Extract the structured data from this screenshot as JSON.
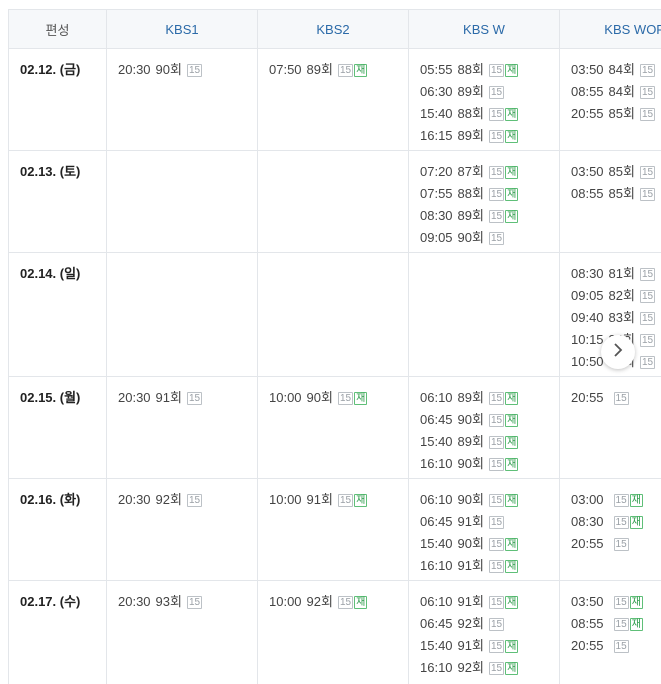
{
  "header": {
    "first": "편성",
    "channels": [
      "KBS1",
      "KBS2",
      "KBS W",
      "KBS WOR"
    ]
  },
  "icons": {
    "next": "chevron-right-icon"
  },
  "badge_labels": {
    "rating": "15",
    "rerun": "재"
  },
  "colors": {
    "channel_header": "#2b6aa8",
    "rerun_badge": "#2e9c4b",
    "rating_badge": "#9aa0a6"
  },
  "rows": [
    {
      "date": "02.12. (금)",
      "height": 102,
      "cells": [
        [
          {
            "time": "20:30",
            "ep": "90회",
            "re": false
          }
        ],
        [
          {
            "time": "07:50",
            "ep": "89회",
            "re": true
          }
        ],
        [
          {
            "time": "05:55",
            "ep": "88회",
            "re": true
          },
          {
            "time": "06:30",
            "ep": "89회",
            "re": false
          },
          {
            "time": "15:40",
            "ep": "88회",
            "re": true
          },
          {
            "time": "16:15",
            "ep": "89회",
            "re": true
          }
        ],
        [
          {
            "time": "03:50",
            "ep": "84회",
            "re": false
          },
          {
            "time": "08:55",
            "ep": "84회",
            "re": false
          },
          {
            "time": "20:55",
            "ep": "85회",
            "re": false
          }
        ]
      ]
    },
    {
      "date": "02.13. (토)",
      "height": 102,
      "cells": [
        [],
        [],
        [
          {
            "time": "07:20",
            "ep": "87회",
            "re": true
          },
          {
            "time": "07:55",
            "ep": "88회",
            "re": true
          },
          {
            "time": "08:30",
            "ep": "89회",
            "re": true
          },
          {
            "time": "09:05",
            "ep": "90회",
            "re": false
          }
        ],
        [
          {
            "time": "03:50",
            "ep": "85회",
            "re": false
          },
          {
            "time": "08:55",
            "ep": "85회",
            "re": false
          }
        ]
      ]
    },
    {
      "date": "02.14. (일)",
      "height": 124,
      "cells": [
        [],
        [],
        [],
        [
          {
            "time": "08:30",
            "ep": "81회",
            "re": false
          },
          {
            "time": "09:05",
            "ep": "82회",
            "re": false
          },
          {
            "time": "09:40",
            "ep": "83회",
            "re": false
          },
          {
            "time": "10:15",
            "ep": "84회",
            "re": false
          },
          {
            "time": "10:50",
            "ep": "85회",
            "re": false
          }
        ]
      ]
    },
    {
      "date": "02.15. (월)",
      "height": 102,
      "cells": [
        [
          {
            "time": "20:30",
            "ep": "91회",
            "re": false
          }
        ],
        [
          {
            "time": "10:00",
            "ep": "90회",
            "re": true
          }
        ],
        [
          {
            "time": "06:10",
            "ep": "89회",
            "re": true
          },
          {
            "time": "06:45",
            "ep": "90회",
            "re": true
          },
          {
            "time": "15:40",
            "ep": "89회",
            "re": true
          },
          {
            "time": "16:10",
            "ep": "90회",
            "re": true
          }
        ],
        [
          {
            "time": "20:55",
            "ep": "",
            "re": false
          }
        ]
      ]
    },
    {
      "date": "02.16. (화)",
      "height": 102,
      "cells": [
        [
          {
            "time": "20:30",
            "ep": "92회",
            "re": false
          }
        ],
        [
          {
            "time": "10:00",
            "ep": "91회",
            "re": true
          }
        ],
        [
          {
            "time": "06:10",
            "ep": "90회",
            "re": true
          },
          {
            "time": "06:45",
            "ep": "91회",
            "re": false
          },
          {
            "time": "15:40",
            "ep": "90회",
            "re": true
          },
          {
            "time": "16:10",
            "ep": "91회",
            "re": true
          }
        ],
        [
          {
            "time": "03:00",
            "ep": "",
            "re": true
          },
          {
            "time": "08:30",
            "ep": "",
            "re": true
          },
          {
            "time": "20:55",
            "ep": "",
            "re": false
          }
        ]
      ]
    },
    {
      "date": "02.17. (수)",
      "height": 102,
      "cells": [
        [
          {
            "time": "20:30",
            "ep": "93회",
            "re": false
          }
        ],
        [
          {
            "time": "10:00",
            "ep": "92회",
            "re": true
          }
        ],
        [
          {
            "time": "06:10",
            "ep": "91회",
            "re": true
          },
          {
            "time": "06:45",
            "ep": "92회",
            "re": false
          },
          {
            "time": "15:40",
            "ep": "91회",
            "re": true
          },
          {
            "time": "16:10",
            "ep": "92회",
            "re": true
          }
        ],
        [
          {
            "time": "03:50",
            "ep": "",
            "re": true
          },
          {
            "time": "08:55",
            "ep": "",
            "re": true
          },
          {
            "time": "20:55",
            "ep": "",
            "re": false
          }
        ]
      ]
    }
  ]
}
